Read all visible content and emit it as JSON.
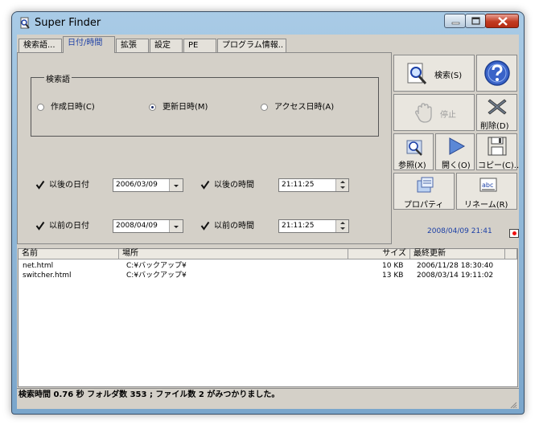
{
  "window": {
    "title": "Super Finder"
  },
  "tabs": [
    {
      "label": "検索語..."
    },
    {
      "label": "日付/時間"
    },
    {
      "label": "拡張"
    },
    {
      "label": "設定"
    },
    {
      "label": "PE"
    },
    {
      "label": "プログラム情報.."
    }
  ],
  "search_group": {
    "title": "検索語",
    "radios": [
      {
        "label": "作成日時(C)",
        "checked": false
      },
      {
        "label": "更新日時(M)",
        "checked": true
      },
      {
        "label": "アクセス日時(A)",
        "checked": false
      }
    ]
  },
  "after": {
    "date_label": "以後の日付",
    "date_value": "2006/03/09",
    "time_label": "以後の時間",
    "time_value": "21:11:25"
  },
  "before": {
    "date_label": "以前の日付",
    "date_value": "2008/04/09",
    "time_label": "以前の時間",
    "time_value": "21:11:25"
  },
  "buttons": {
    "search": "検索(S)",
    "stop": "停止",
    "delete": "削除(D)",
    "browse": "参照(X)",
    "open": "開く(O)",
    "copy": "コピー(C)..",
    "properties": "プロパティ",
    "rename": "リネーム(R)"
  },
  "datetime": "2008/04/09 21:41",
  "results": {
    "columns": [
      "名前",
      "場所",
      "サイズ",
      "最終更新"
    ],
    "rows": [
      {
        "name": "net.html",
        "location": "C:¥バックアップ¥",
        "size": "10 KB",
        "modified": "2006/11/28 18:30:40"
      },
      {
        "name": "switcher.html",
        "location": "C:¥バックアップ¥",
        "size": "13 KB",
        "modified": "2008/03/14 19:11:02"
      }
    ]
  },
  "status": "検索時間 0.76 秒 フォルダ数 353 ; ファイル数 2 がみつかりました。",
  "colors": {
    "accent": "#1b3fa6",
    "face": "#d4d0c8",
    "close": "#c23b22"
  }
}
